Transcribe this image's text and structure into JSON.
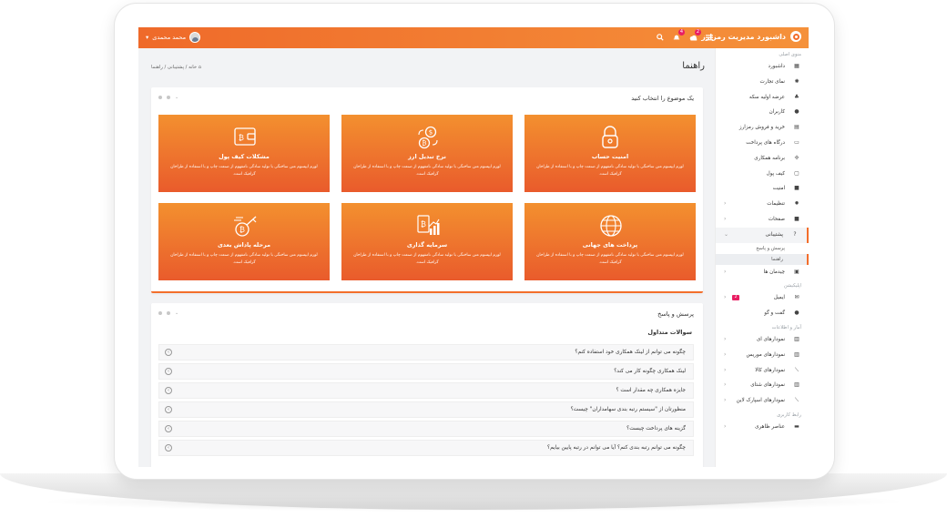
{
  "topbar": {
    "brand": "داشبورد مدیریت رمزارز",
    "user_name": "محمد محمدی",
    "notif_badge_1": "4",
    "notif_badge_2": "2"
  },
  "main": {
    "title": "راهنما",
    "breadcrumb": {
      "home": "خانه",
      "sep": "/",
      "support": "پشتیبانی",
      "current": "راهنما"
    }
  },
  "topics": {
    "title": "یک موضوع را انتخاب کنید",
    "cards": [
      {
        "title": "امنیت حساب",
        "desc": "لورم ایپسوم متن ساختگی با تولید سادگی نامفهوم از صنعت چاپ و با استفاده از طراحان گرافیک است.",
        "icon": "lock-icon"
      },
      {
        "title": "نرخ تبدیل ارز",
        "desc": "لورم ایپسوم متن ساختگی با تولید سادگی نامفهوم از صنعت چاپ و با استفاده از طراحان گرافیک است.",
        "icon": "exchange-icon"
      },
      {
        "title": "مشکلات کیف پول",
        "desc": "لورم ایپسوم متن ساختگی با تولید سادگی نامفهوم از صنعت چاپ و با استفاده از طراحان گرافیک است.",
        "icon": "wallet-icon"
      },
      {
        "title": "پرداخت های جهانی",
        "desc": "لورم ایپسوم متن ساختگی با تولید سادگی نامفهوم از صنعت چاپ و با استفاده از طراحان گرافیک است.",
        "icon": "globe-icon"
      },
      {
        "title": "سرمایه گذاری",
        "desc": "لورم ایپسوم متن ساختگی با تولید سادگی نامفهوم از صنعت چاپ و با استفاده از طراحان گرافیک است.",
        "icon": "growth-chart-icon"
      },
      {
        "title": "مرحله پاداش بعدی",
        "desc": "لورم ایپسوم متن ساختگی با تولید سادگی نامفهوم از صنعت چاپ و با استفاده از طراحان گرافیک است.",
        "icon": "reward-key-icon"
      }
    ]
  },
  "faq": {
    "title": "پرسش و پاسخ",
    "heading": "سوالات متداول",
    "items": [
      "چگونه می توانم از لینک همکاری خود استفاده کنم؟",
      "لینک همکاری چگونه کار می کند؟",
      "جایزه همکاری چه مقدار است ؟",
      "منظورتان از \"سیستم رتبه بندی سهامداران\" چیست؟",
      "گزینه های پرداخت چیست؟",
      "چگونه می توانم رتبه بندی کنم؟ آیا می توانم در رتبه پایین بیایم؟"
    ]
  },
  "sidebar": {
    "section_main": "منوی اصلی",
    "main_items": [
      {
        "label": "داشبورد",
        "icon": "grid-icon"
      },
      {
        "label": "نمای تجارت",
        "icon": "sun-icon"
      },
      {
        "label": "عرضه اولیه سکه",
        "icon": "sitemap-icon"
      },
      {
        "label": "کاربران",
        "icon": "user-icon"
      },
      {
        "label": "خرید و فروش رمزارز",
        "icon": "database-icon"
      },
      {
        "label": "درگاه های پرداخت",
        "icon": "card-icon"
      },
      {
        "label": "برنامه همکاری",
        "icon": "crosshair-icon"
      },
      {
        "label": "کیف پول",
        "icon": "wallet-icon"
      },
      {
        "label": "امنیت",
        "icon": "lock-icon"
      },
      {
        "label": "تنظیمات",
        "icon": "gear-icon"
      },
      {
        "label": "صفحات",
        "icon": "lock-icon"
      },
      {
        "label": "پشتیبانی",
        "icon": "question-icon"
      }
    ],
    "support_sub": [
      "پرسش و پاسخ",
      "راهنما"
    ],
    "layouts": {
      "label": "چیدمان ها",
      "icon": "layout-icon"
    },
    "section_apps": "اپلیکیشن",
    "apps": [
      {
        "label": "ایمیل",
        "icon": "mail-icon",
        "badge": "2"
      },
      {
        "label": "گفت و گو",
        "icon": "chat-icon"
      }
    ],
    "section_charts": "آمار و اطلاعات",
    "charts": [
      {
        "label": "نمودارهای ای",
        "icon": "bar-chart-icon"
      },
      {
        "label": "نمودارهای موریس",
        "icon": "bar-chart-icon"
      },
      {
        "label": "نمودارهای کالا",
        "icon": "line-chart-icon"
      },
      {
        "label": "نمودارهای شتای",
        "icon": "bar-chart-icon"
      },
      {
        "label": "نمودارهای اسپارک لاین",
        "icon": "line-chart-icon"
      }
    ],
    "section_ui": "رابط کاربری",
    "ui": [
      {
        "label": "عناصر ظاهری",
        "icon": "folder-icon"
      }
    ]
  }
}
